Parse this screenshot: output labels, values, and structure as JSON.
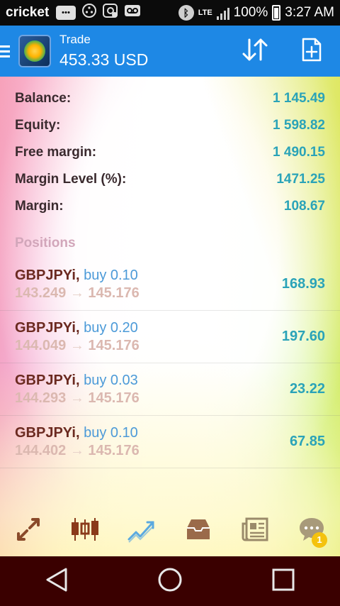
{
  "status_bar": {
    "carrier": "cricket",
    "network": "LTE",
    "battery": "100%",
    "time": "3:27 AM",
    "icons": [
      "message-icon",
      "voicemail-dots-icon",
      "sync-notification-icon",
      "voicemail-icon",
      "bluetooth-icon",
      "signal-icon",
      "battery-icon"
    ]
  },
  "header": {
    "title": "Trade",
    "subtitle": "453.33 USD",
    "actions": [
      "sort-arrows-icon",
      "new-order-icon"
    ]
  },
  "summary": [
    {
      "label": "Balance:",
      "value": "1 145.49"
    },
    {
      "label": "Equity:",
      "value": "1 598.82"
    },
    {
      "label": "Free margin:",
      "value": "1 490.15"
    },
    {
      "label": "Margin Level (%):",
      "value": "1471.25"
    },
    {
      "label": "Margin:",
      "value": "108.67"
    }
  ],
  "positions_title": "Positions",
  "positions": [
    {
      "symbol": "GBPJPYi,",
      "side": "buy 0.10",
      "open": "143.249",
      "arrow": "→",
      "current": "145.176",
      "profit": "168.93"
    },
    {
      "symbol": "GBPJPYi,",
      "side": "buy 0.20",
      "open": "144.049",
      "arrow": "→",
      "current": "145.176",
      "profit": "197.60"
    },
    {
      "symbol": "GBPJPYi,",
      "side": "buy 0.03",
      "open": "144.293",
      "arrow": "→",
      "current": "145.176",
      "profit": "23.22"
    },
    {
      "symbol": "GBPJPYi,",
      "side": "buy 0.10",
      "open": "144.402",
      "arrow": "→",
      "current": "145.176",
      "profit": "67.85"
    }
  ],
  "toolbar": {
    "items": [
      "quotes-arrows-icon",
      "chart-candles-icon",
      "trade-trend-icon",
      "history-inbox-icon",
      "news-icon",
      "chat-icon"
    ],
    "chat_badge": "1"
  },
  "colors": {
    "header_bg": "#1e88e5",
    "value": "#2aa3b8",
    "nav_bg": "#3a0000"
  }
}
